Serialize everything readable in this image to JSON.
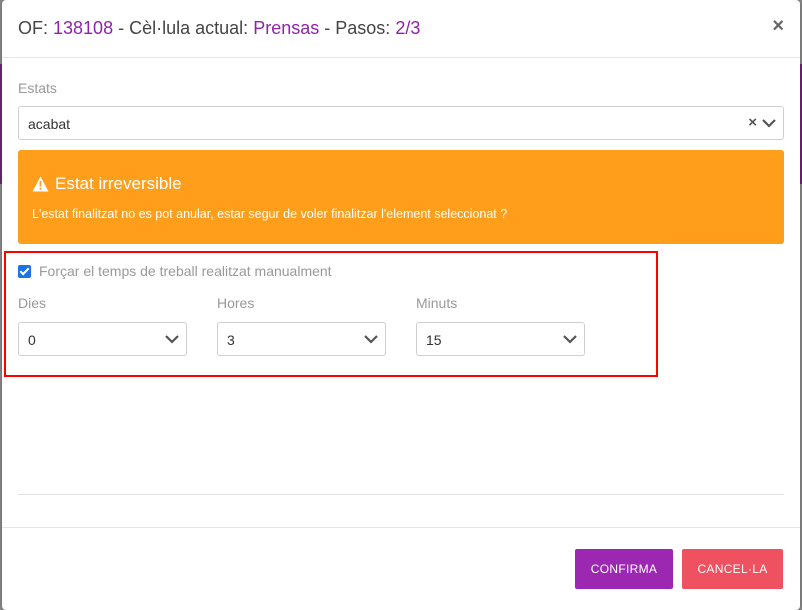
{
  "header": {
    "of_label": "OF:",
    "of_value": "138108",
    "sep1": "-",
    "cell_label": "Cèl·lula actual:",
    "cell_value": "Prensas",
    "sep2": "-",
    "steps_label": "Pasos:",
    "steps_value": "2/3",
    "close": "×"
  },
  "state_field": {
    "label": "Estats",
    "value": "acabat"
  },
  "alert": {
    "title": "Estat irreversible",
    "text": "L'estat finalitzat no es pot anular, estar segur de voler finalitzar l'element seleccionat ?"
  },
  "manual_time": {
    "checked": true,
    "label": "Forçar el temps de treball realitzat manualment",
    "days": {
      "label": "Dies",
      "value": "0"
    },
    "hours": {
      "label": "Hores",
      "value": "3"
    },
    "minutes": {
      "label": "Minuts",
      "value": "15"
    }
  },
  "footer": {
    "confirm_label": "CONFIRMA",
    "cancel_label": "CANCEL·LA"
  },
  "colors": {
    "accent": "#8e24aa",
    "warning": "#ff9e1b",
    "confirm": "#9c27b0",
    "cancel": "#ef5160",
    "highlight": "#ff0000"
  }
}
